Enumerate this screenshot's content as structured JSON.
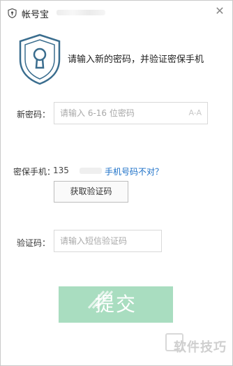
{
  "window": {
    "title": "帐号宝",
    "close_label": "✕"
  },
  "header": {
    "headline": "请输入新的密码，并验证密保手机"
  },
  "form": {
    "new_password_label": "新密码：",
    "new_password_placeholder": "请输入 6-16 位密码",
    "password_toggle": "A-A",
    "security_phone_label": "密保手机：",
    "security_phone_value": "135",
    "phone_wrong_link": "手机号码不对？",
    "get_code_button": "获取验证码",
    "code_label": "验证码：",
    "code_placeholder": "请输入短信验证码"
  },
  "actions": {
    "submit_label": "提交"
  },
  "watermark": {
    "text": "软件技巧"
  },
  "colors": {
    "accent_blue": "#1a6fc7",
    "submit_bg": "#a9ddc0",
    "shield_stroke": "#3a6d8e"
  }
}
